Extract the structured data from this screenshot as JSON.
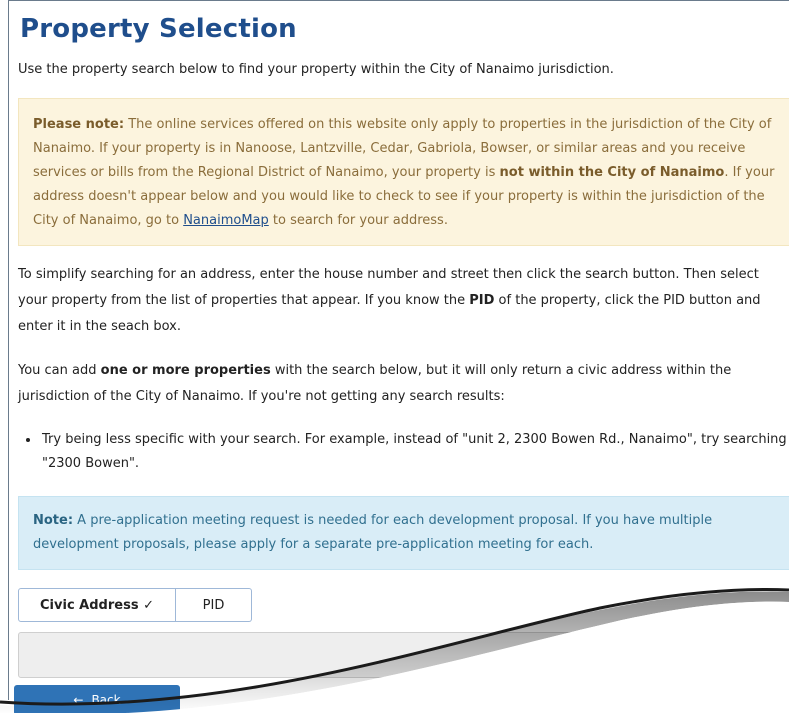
{
  "page": {
    "title": "Property Selection",
    "intro": "Use the property search below to find your property within the City of Nanaimo jurisdiction."
  },
  "note_box": {
    "label": "Please note:",
    "text_1": " The online services offered on this website only apply to properties in the jurisdiction of the City of Nanaimo. If your property is in Nanoose, Lantzville, Cedar, Gabriola, Bowser, or similar areas and you receive services or bills from the Regional District of Nanaimo, your property is ",
    "emphasis": "not within the City of Nanaimo",
    "text_2": ". If your address doesn't appear below and you would like to check to see if your property is within the jurisdiction of the City of Nanaimo, go to ",
    "link": "NanaimoMap",
    "text_3": " to search for your address."
  },
  "instructions": {
    "p1_a": "To simplify searching for an address, enter the house number and street then click the search button. Then select your property from the list of properties that appear. If you know the ",
    "p1_bold": "PID",
    "p1_b": " of the property, click the PID button and enter it in the seach box.",
    "p2_a": "You can add ",
    "p2_bold": "one or more properties",
    "p2_b": " with the search below, but it will only return a civic address within the jurisdiction of the City of Nanaimo. If you're not getting any search results:",
    "bullets": [
      "Try being less specific with your search. For example, instead of \"unit 2, 2300 Bowen Rd., Nanaimo\", try searching \"2300 Bowen\"."
    ]
  },
  "info_box": {
    "label": "Note:",
    "text": " A pre-application meeting request is needed for each development proposal. If you have multiple development proposals, please apply for a separate pre-application meeting for each."
  },
  "search": {
    "tab_civic": "Civic Address ✓",
    "tab_pid": "PID",
    "active_tab": "Civic Address",
    "value": "",
    "placeholder": ""
  },
  "actions": {
    "back_icon": "←",
    "back_label": "Back"
  },
  "colors": {
    "title": "#1f4e8c",
    "note_bg": "#fcf4de",
    "info_bg": "#d9edf7",
    "button_bg": "#2f73b6"
  }
}
